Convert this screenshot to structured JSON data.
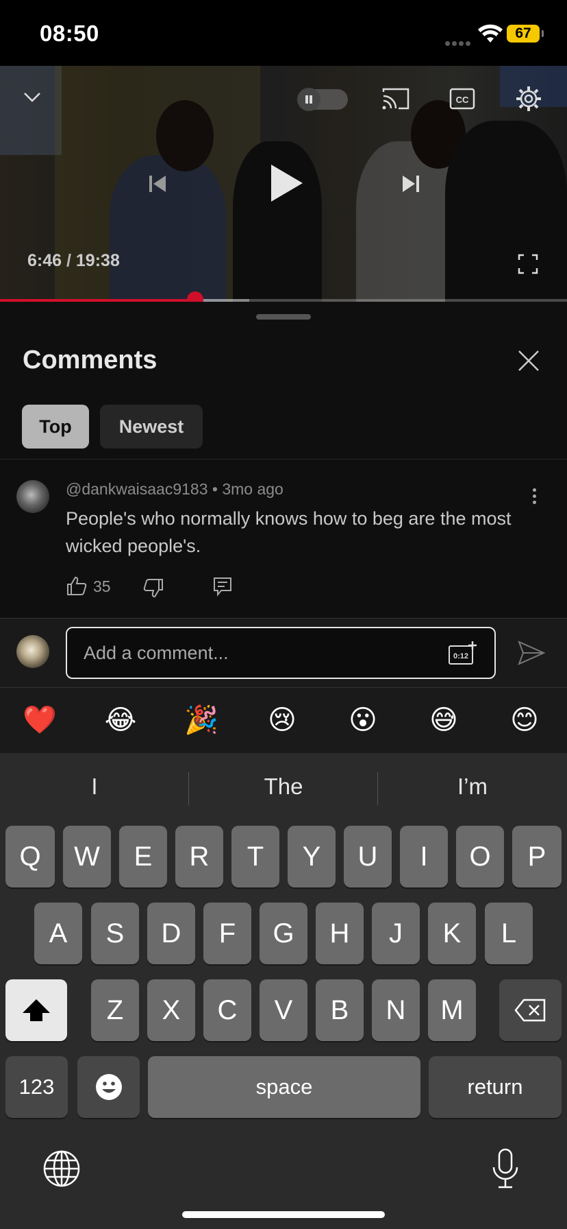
{
  "status_bar": {
    "time": "08:50",
    "battery": "67"
  },
  "video": {
    "current_time": "6:46",
    "separator": "/",
    "duration": "19:38",
    "progress_fraction": 0.344,
    "buffered_fraction": 0.44
  },
  "comments": {
    "title": "Comments",
    "tabs": [
      {
        "label": "Top",
        "selected": true
      },
      {
        "label": "Newest",
        "selected": false
      }
    ],
    "items": [
      {
        "author": "@dankwaisaac9183",
        "age": "3mo ago",
        "text": "People's who normally knows how to beg are the most wicked people's.",
        "likes": "35"
      }
    ]
  },
  "compose": {
    "placeholder": "Add a comment...",
    "timestamp_badge": "0:12"
  },
  "emoji_reactions": [
    "❤️",
    "😂",
    "🎉",
    "😢",
    "😮",
    "😅",
    "😊"
  ],
  "keyboard": {
    "suggestions": [
      "I",
      "The",
      "I’m"
    ],
    "row1": [
      "Q",
      "W",
      "E",
      "R",
      "T",
      "Y",
      "U",
      "I",
      "O",
      "P"
    ],
    "row2": [
      "A",
      "S",
      "D",
      "F",
      "G",
      "H",
      "J",
      "K",
      "L"
    ],
    "row3": [
      "Z",
      "X",
      "C",
      "V",
      "B",
      "N",
      "M"
    ],
    "numbers_key": "123",
    "space_key": "space",
    "return_key": "return"
  },
  "colors": {
    "accent_red": "#d0102a",
    "battery_yellow": "#f5c800"
  }
}
